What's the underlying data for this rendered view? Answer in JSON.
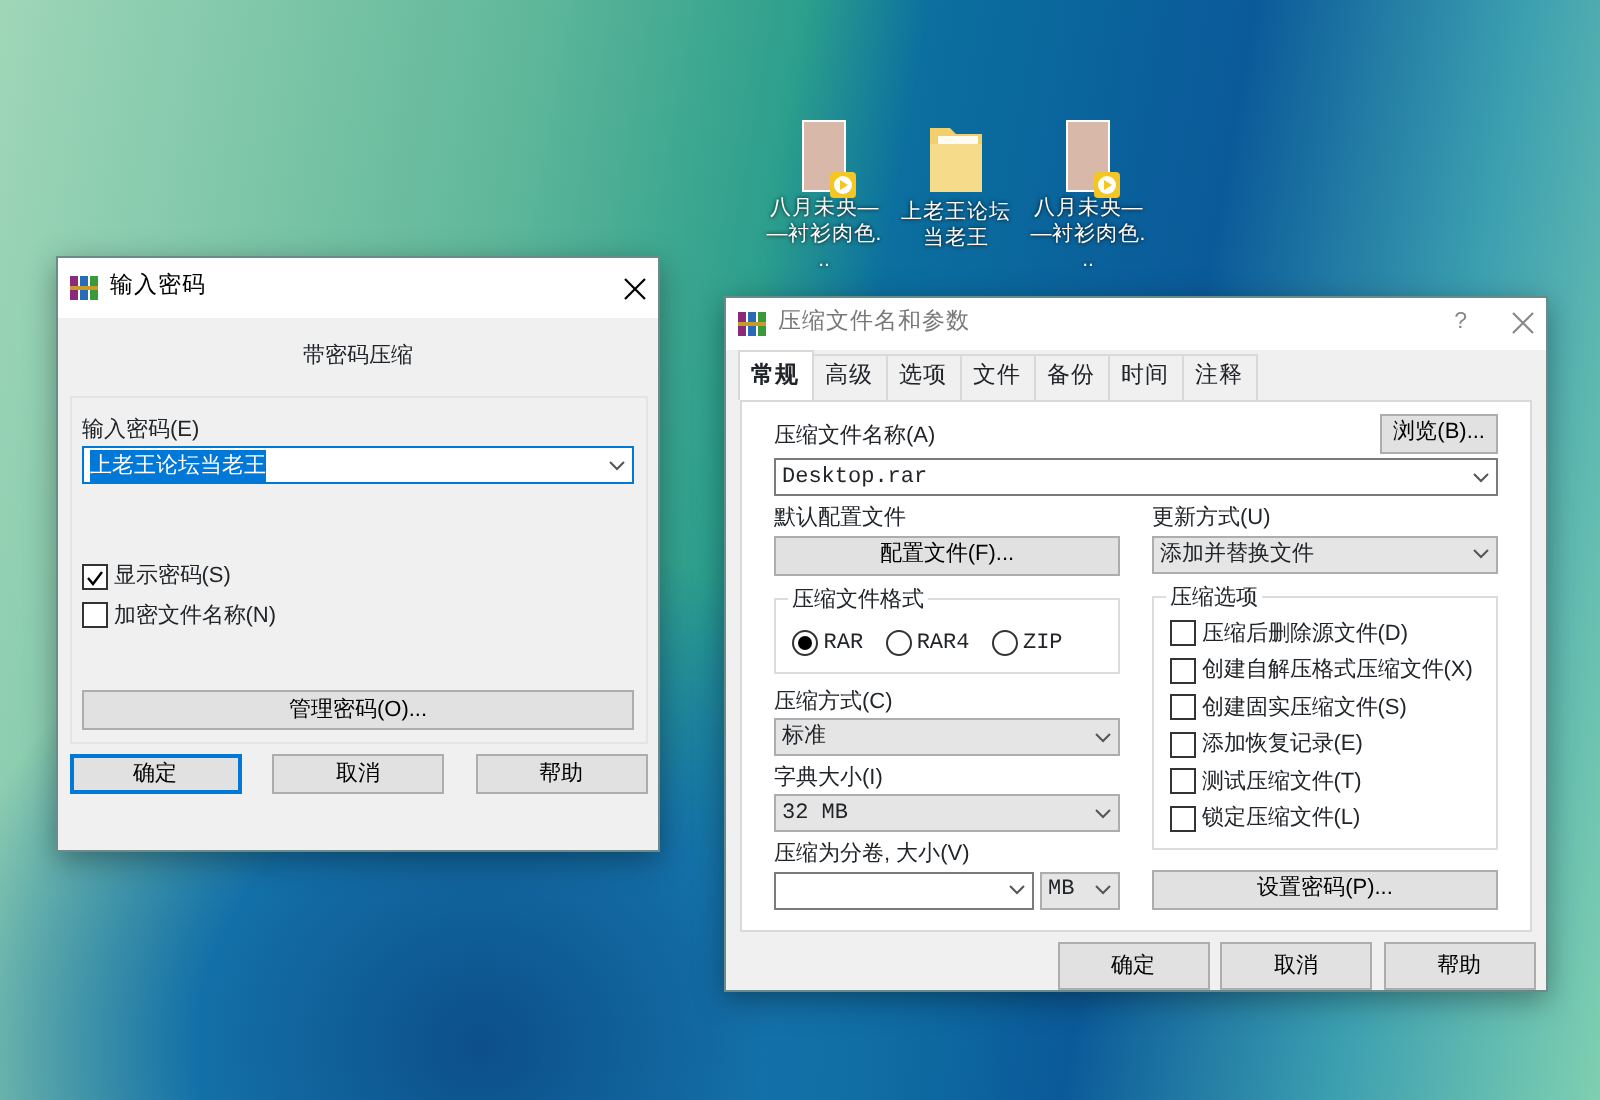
{
  "desktop_icons": [
    {
      "kind": "video",
      "label": "八月未央——衬衫肉色..."
    },
    {
      "kind": "folder",
      "label": "上老王论坛当老王"
    },
    {
      "kind": "video",
      "label": "八月未央——衬衫肉色..."
    }
  ],
  "password_dialog": {
    "title": "输入密码",
    "heading": "带密码压缩",
    "password_label": "输入密码(E)",
    "password_value": "上老王论坛当老王",
    "value_highlighted": true,
    "checkboxes": [
      {
        "label": "显示密码(S)",
        "checked": true
      },
      {
        "label": "加密文件名称(N)",
        "checked": false
      }
    ],
    "manage_button": "管理密码(O)...",
    "buttons": [
      {
        "label": "确定",
        "focused": true
      },
      {
        "label": "取消",
        "focused": false
      },
      {
        "label": "帮助",
        "focused": false
      }
    ]
  },
  "archive_dialog": {
    "title": "压缩文件名和参数",
    "help_glyph": "?",
    "tabs": [
      {
        "label": "常规",
        "selected": true
      },
      {
        "label": "高级",
        "selected": false
      },
      {
        "label": "选项",
        "selected": false
      },
      {
        "label": "文件",
        "selected": false
      },
      {
        "label": "备份",
        "selected": false
      },
      {
        "label": "时间",
        "selected": false
      },
      {
        "label": "注释",
        "selected": false
      }
    ],
    "archive_name_label": "压缩文件名称(A)",
    "browse_button": "浏览(B)...",
    "archive_name_value": "Desktop.rar",
    "profile_label": "默认配置文件",
    "profile_button": "配置文件(F)...",
    "update_label": "更新方式(U)",
    "update_value": "添加并替换文件",
    "format_label": "压缩文件格式",
    "formats": [
      {
        "label": "RAR",
        "selected": true
      },
      {
        "label": "RAR4",
        "selected": false
      },
      {
        "label": "ZIP",
        "selected": false
      }
    ],
    "method_label": "压缩方式(C)",
    "method_value": "标准",
    "dictionary_label": "字典大小(I)",
    "dictionary_value": "32 MB",
    "split_label": "压缩为分卷, 大小(V)",
    "split_unit": "MB",
    "options_label": "压缩选项",
    "options": [
      {
        "label": "压缩后删除源文件(D)",
        "checked": false
      },
      {
        "label": "创建自解压格式压缩文件(X)",
        "checked": false
      },
      {
        "label": "创建固实压缩文件(S)",
        "checked": false
      },
      {
        "label": "添加恢复记录(E)",
        "checked": false
      },
      {
        "label": "测试压缩文件(T)",
        "checked": false
      },
      {
        "label": "锁定压缩文件(L)",
        "checked": false
      }
    ],
    "set_password_button": "设置密码(P)...",
    "buttons": [
      {
        "label": "确定",
        "focused": false
      },
      {
        "label": "取消",
        "focused": false
      },
      {
        "label": "帮助",
        "focused": false
      }
    ]
  }
}
